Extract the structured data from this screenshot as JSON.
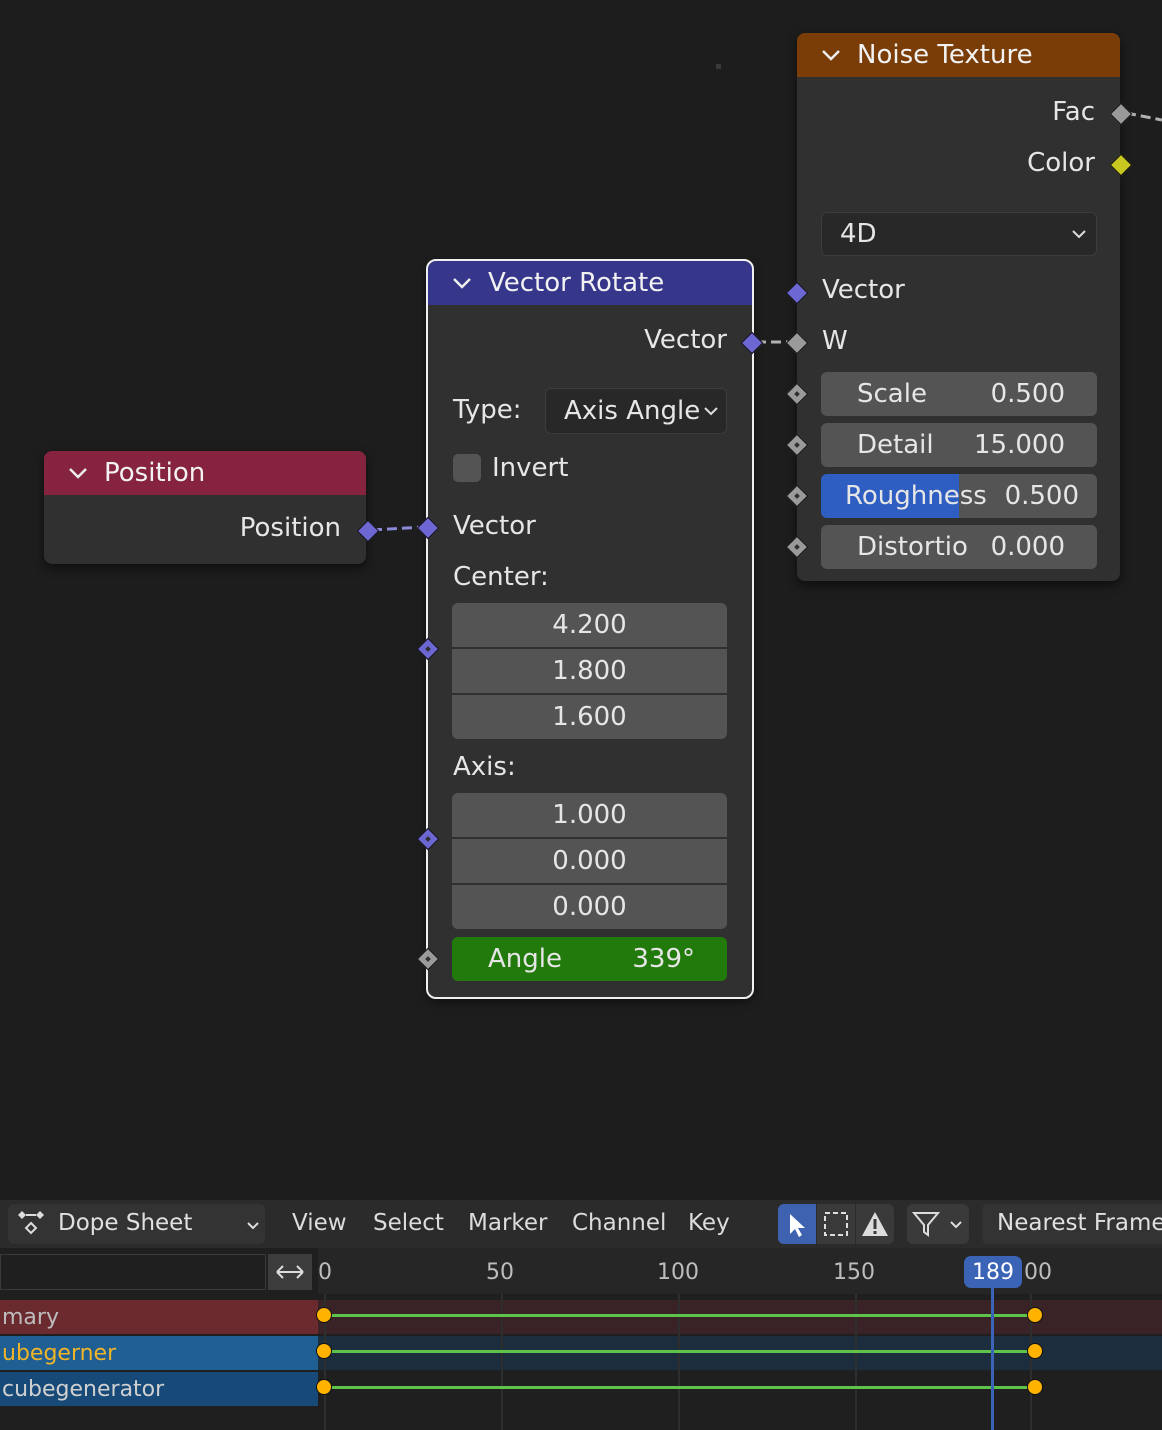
{
  "nodes": {
    "noise": {
      "title": "Noise Texture",
      "header_color": "#7a3d08",
      "outputs": [
        "Fac",
        "Color"
      ],
      "dimension": "4D",
      "inputs": {
        "vector": "Vector",
        "w": "W"
      },
      "fields": [
        {
          "label": "Scale",
          "value": "0.500"
        },
        {
          "label": "Detail",
          "value": "15.000"
        },
        {
          "label": "Roughness",
          "value": "0.500",
          "fill": 0.5
        },
        {
          "label": "Distortio",
          "value": "0.000"
        }
      ]
    },
    "rotate": {
      "title": "Vector Rotate",
      "header_color": "#36368a",
      "output": "Vector",
      "type_label": "Type:",
      "type_value": "Axis Angle",
      "invert_label": "Invert",
      "vector_label": "Vector",
      "center_label": "Center:",
      "center": [
        "4.200",
        "1.800",
        "1.600"
      ],
      "axis_label": "Axis:",
      "axis": [
        "1.000",
        "0.000",
        "0.000"
      ],
      "angle_label": "Angle",
      "angle_value": "339°",
      "angle_color": "#227a0c"
    },
    "position": {
      "title": "Position",
      "header_color": "#862440",
      "output": "Position"
    }
  },
  "dope_sheet": {
    "editor_type": "Dope Sheet",
    "menus": [
      "View",
      "Select",
      "Marker",
      "Channel",
      "Key"
    ],
    "snap": "Nearest Frame",
    "ruler_ticks": [
      "0",
      "50",
      "100",
      "150"
    ],
    "current_frame": "189",
    "partial_tick": "00",
    "channels": [
      {
        "name": "mary",
        "color": "#7a2d33",
        "text_color": "#bdbdbd"
      },
      {
        "name": "ubegerner",
        "color": "#1f5f93",
        "text_color": "#f0b429"
      },
      {
        "name": "cubegenerator",
        "color": "#174a78",
        "text_color": "#d0d0d0"
      }
    ]
  }
}
